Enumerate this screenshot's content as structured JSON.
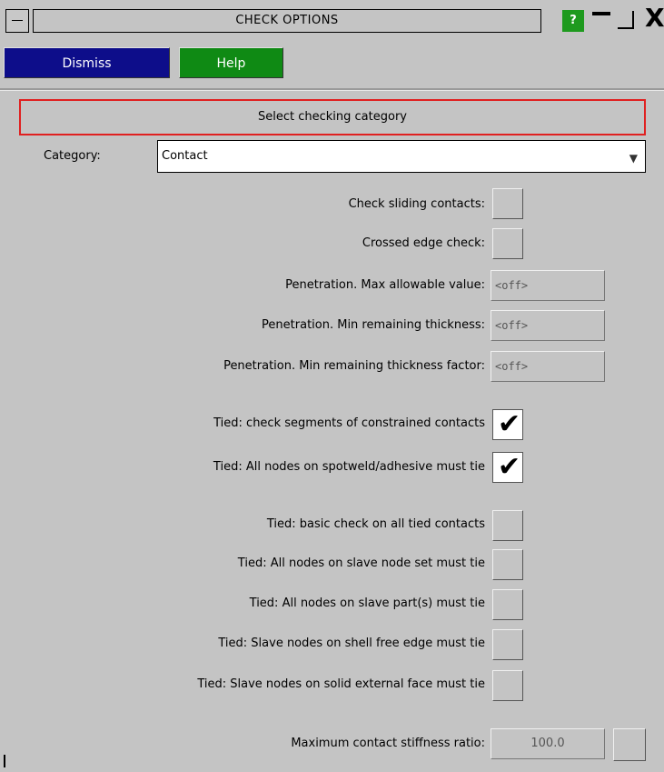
{
  "window": {
    "title": "CHECK OPTIONS",
    "help_glyph": "?",
    "close_glyph": "X"
  },
  "toolbar": {
    "dismiss_label": "Dismiss",
    "help_label": "Help"
  },
  "section": {
    "header": "Select checking category"
  },
  "category": {
    "label": "Category:",
    "value": "Contact"
  },
  "options": {
    "sliding": {
      "label": "Check sliding contacts:",
      "checked": false
    },
    "crossed": {
      "label": "Crossed edge check:",
      "checked": false
    },
    "pen_max": {
      "label": "Penetration. Max allowable value:",
      "value": "<off>"
    },
    "pen_min": {
      "label": "Penetration. Min remaining thickness:",
      "value": "<off>"
    },
    "pen_factor": {
      "label": "Penetration. Min remaining thickness factor:",
      "value": "<off>"
    },
    "tied_constrained": {
      "label": "Tied: check segments of constrained contacts",
      "checked": true
    },
    "tied_spotweld": {
      "label": "Tied: All nodes on spotweld/adhesive must tie",
      "checked": true
    },
    "tied_basic": {
      "label": "Tied: basic check on all tied contacts",
      "checked": false
    },
    "tied_slave_set": {
      "label": "Tied: All nodes on slave node set must tie",
      "checked": false
    },
    "tied_slave_parts": {
      "label": "Tied: All nodes on slave part(s) must tie",
      "checked": false
    },
    "tied_shell_edge": {
      "label": "Tied: Slave nodes on shell free edge must tie",
      "checked": false
    },
    "tied_solid_face": {
      "label": "Tied: Slave nodes on solid external face must tie",
      "checked": false
    },
    "stiffness": {
      "label": "Maximum contact stiffness ratio:",
      "value": "100.0"
    }
  },
  "marks": {
    "check": "✔"
  },
  "colors": {
    "dismiss_bg": "#0d0d8a",
    "help_bg": "#0f8a14",
    "section_border": "#e02020",
    "panel_bg": "#c4c4c4"
  }
}
